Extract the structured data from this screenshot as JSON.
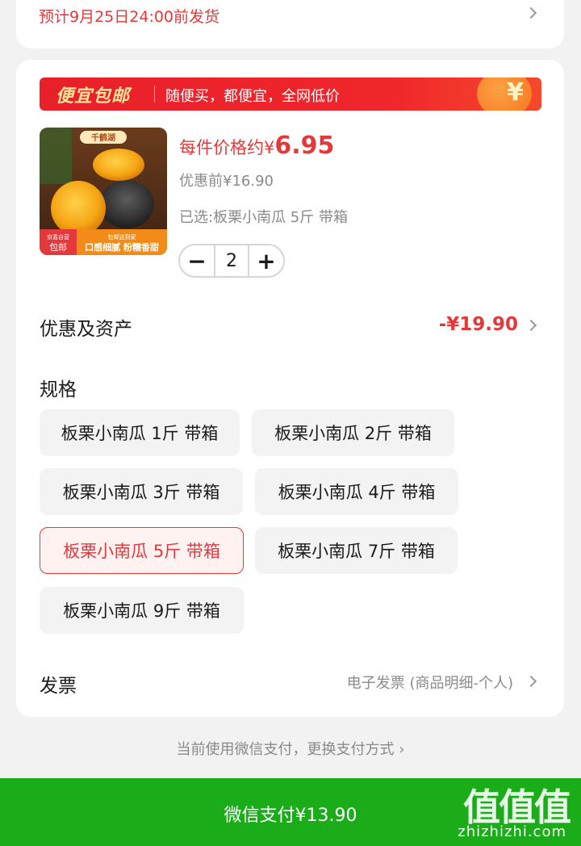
{
  "shipping": {
    "text": "预计9月25日24:00前发货"
  },
  "banner": {
    "title": "便宜包邮",
    "subtitle": "随便买，都便宜，全网低价",
    "coin": "¥"
  },
  "product": {
    "image_labels": {
      "brand": "千鹤湖",
      "badge_top": "京喜自营",
      "badge_bottom": "包邮",
      "tagline": "口感细腻 粉糯香甜",
      "small": "包邮送到家"
    },
    "price_prefix": "每件价格约¥",
    "price": "6.95",
    "before_price": "优惠前¥16.90",
    "selected": "已选:板栗小南瓜 5斤 带箱"
  },
  "stepper": {
    "minus": "−",
    "value": "2",
    "plus": "+"
  },
  "discount": {
    "label": "优惠及资产",
    "value": "-¥19.90"
  },
  "spec": {
    "label": "规格",
    "options": [
      "板栗小南瓜 1斤 带箱",
      "板栗小南瓜 2斤 带箱",
      "板栗小南瓜 3斤 带箱",
      "板栗小南瓜 4斤 带箱",
      "板栗小南瓜 5斤 带箱",
      "板栗小南瓜 7斤 带箱",
      "板栗小南瓜 9斤 带箱"
    ],
    "selected_index": 4
  },
  "invoice": {
    "label": "发票",
    "value": "电子发票 (商品明细-个人)"
  },
  "payment": {
    "hint": "当前使用微信支付，更换支付方式 ›",
    "button": "微信支付¥13.90"
  },
  "watermark": {
    "big": "值值值",
    "small": "zhizhizhi.com"
  },
  "colors": {
    "accent_red": "#e4393c",
    "pay_green": "#1aad19",
    "banner_red": "#f0262c"
  }
}
